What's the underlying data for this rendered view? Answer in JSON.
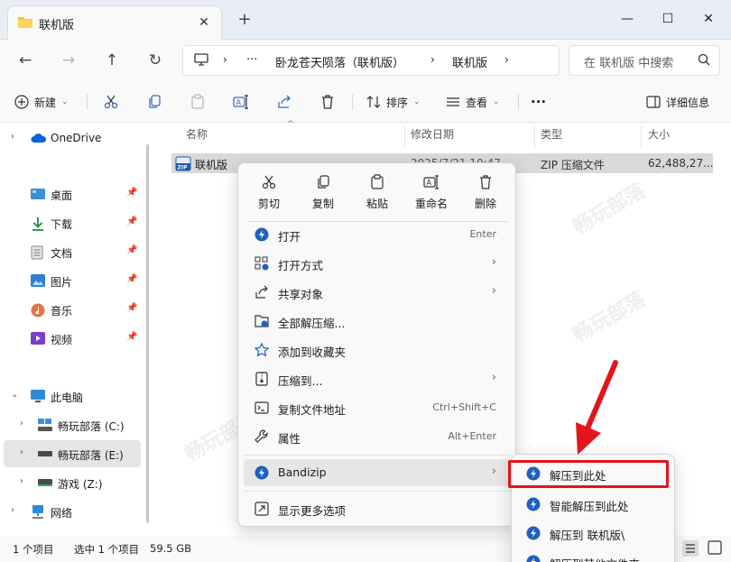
{
  "colors": {
    "accent": "#0067c0",
    "red": "#e3141b",
    "selection": "#d9d9d9"
  },
  "window": {
    "tab_title": "联机版",
    "new_tab": "+",
    "minimize": "—",
    "maximize": "☐",
    "close": "✕"
  },
  "nav": {
    "breadcrumb": [
      "卧龙苍天陨落（联机版）",
      "联机版"
    ],
    "ellipsis": "···",
    "search_placeholder": "在 联机版 中搜索"
  },
  "toolbar": {
    "new": "新建",
    "sort": "排序",
    "view": "查看",
    "more": "···",
    "details": "详细信息"
  },
  "sidebar": {
    "onedrive": "OneDrive",
    "quick": [
      {
        "label": "桌面",
        "icon": "desktop-icon"
      },
      {
        "label": "下载",
        "icon": "download-icon"
      },
      {
        "label": "文档",
        "icon": "document-icon"
      },
      {
        "label": "图片",
        "icon": "picture-icon"
      },
      {
        "label": "音乐",
        "icon": "music-icon"
      },
      {
        "label": "视频",
        "icon": "video-icon"
      }
    ],
    "thispc": "此电脑",
    "drives": [
      {
        "label": "畅玩部落 (C:)"
      },
      {
        "label": "畅玩部落 (E:)"
      },
      {
        "label": "游戏 (Z:)"
      }
    ],
    "network": "网络"
  },
  "filelist": {
    "columns": [
      "名称",
      "修改日期",
      "类型",
      "大小"
    ],
    "rows": [
      {
        "name": "联机版",
        "date": "2025/7/21 10:47",
        "type": "ZIP 压缩文件",
        "size": "62,488,27..."
      }
    ]
  },
  "status": {
    "count": "1 个项目",
    "selected": "选中 1 个项目",
    "size": "59.5 GB"
  },
  "context_menu": {
    "quick_actions": [
      "剪切",
      "复制",
      "粘贴",
      "重命名",
      "删除"
    ],
    "items": [
      {
        "label": "打开",
        "accel": "Enter"
      },
      {
        "label": "打开方式",
        "accel": ""
      },
      {
        "label": "共享对象",
        "accel": ""
      },
      {
        "label": "全部解压缩...",
        "accel": ""
      },
      {
        "label": "添加到收藏夹",
        "accel": ""
      },
      {
        "label": "压缩到...",
        "accel": ""
      },
      {
        "label": "复制文件地址",
        "accel": "Ctrl+Shift+C"
      },
      {
        "label": "属性",
        "accel": "Alt+Enter"
      },
      {
        "label": "Bandizip",
        "accel": ""
      },
      {
        "label": "显示更多选项",
        "accel": ""
      }
    ]
  },
  "submenu": {
    "items": [
      "解压到此处",
      "智能解压到此处",
      "解压到 联机版\\",
      "解压到其他文件夹"
    ]
  }
}
